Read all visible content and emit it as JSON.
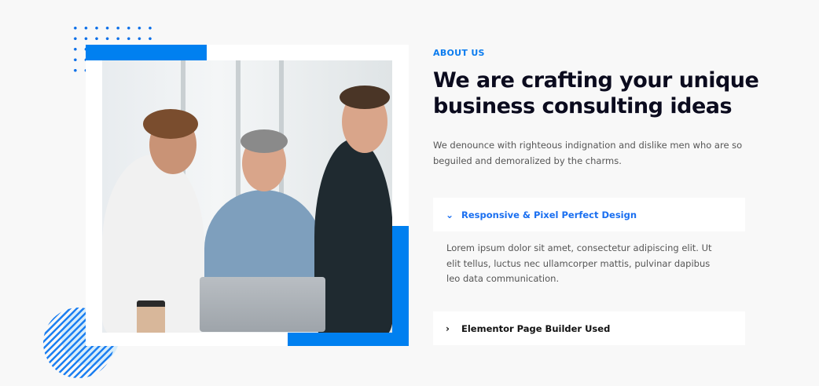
{
  "about": {
    "label": "ABOUT US",
    "heading_line1": "We are crafting your unique",
    "heading_line2": "business consulting ideas",
    "description": "We denounce with righteous indignation and dislike men who are so beguiled and demoralized by the charms."
  },
  "accordion": [
    {
      "title": "Responsive & Pixel Perfect Design",
      "expanded": true,
      "icon": "chevron-down-icon",
      "body": "Lorem ipsum dolor sit amet, consectetur adipiscing elit. Ut elit tellus, luctus nec ullamcorper mattis, pulvinar dapibus leo data communication."
    },
    {
      "title": "Elementor Page Builder Used",
      "expanded": false,
      "icon": "chevron-right-icon"
    }
  ],
  "colors": {
    "accent": "#0080f0",
    "heading": "#0b0b1e",
    "background": "#f8f8f8"
  }
}
